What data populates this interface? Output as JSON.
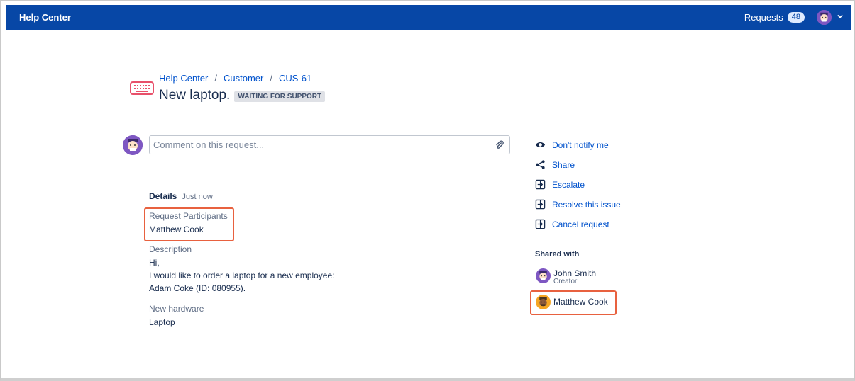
{
  "topbar": {
    "brand": "Help Center",
    "requests_label": "Requests",
    "requests_count": "48"
  },
  "breadcrumb": [
    "Help Center",
    "Customer",
    "CUS-61"
  ],
  "request": {
    "title": "New laptop.",
    "status": "WAITING FOR SUPPORT"
  },
  "comment": {
    "placeholder": "Comment on this request..."
  },
  "details": {
    "label": "Details",
    "time": "Just now",
    "fields": [
      {
        "label": "Request Participants",
        "value": [
          "Matthew Cook"
        ]
      },
      {
        "label": "Description",
        "value": [
          "Hi,",
          "I would like to order a laptop for a new employee:",
          "Adam Coke (ID: 080955)."
        ]
      },
      {
        "label": "New hardware",
        "value": [
          "Laptop"
        ]
      }
    ]
  },
  "actions": [
    {
      "label": "Don't notify me",
      "icon": "eye-icon"
    },
    {
      "label": "Share",
      "icon": "share-icon"
    },
    {
      "label": "Escalate",
      "icon": "transition-icon"
    },
    {
      "label": "Resolve this issue",
      "icon": "transition-icon"
    },
    {
      "label": "Cancel request",
      "icon": "transition-icon"
    }
  ],
  "shared": {
    "heading": "Shared with",
    "people": [
      {
        "name": "John Smith",
        "role": "Creator",
        "avatar_color": "#7e57c2"
      },
      {
        "name": "Matthew Cook",
        "role": "",
        "avatar_color": "#f5a623"
      }
    ]
  },
  "colors": {
    "topbar": "#0747a6",
    "link": "#0052cc",
    "highlight": "#e8613f"
  }
}
